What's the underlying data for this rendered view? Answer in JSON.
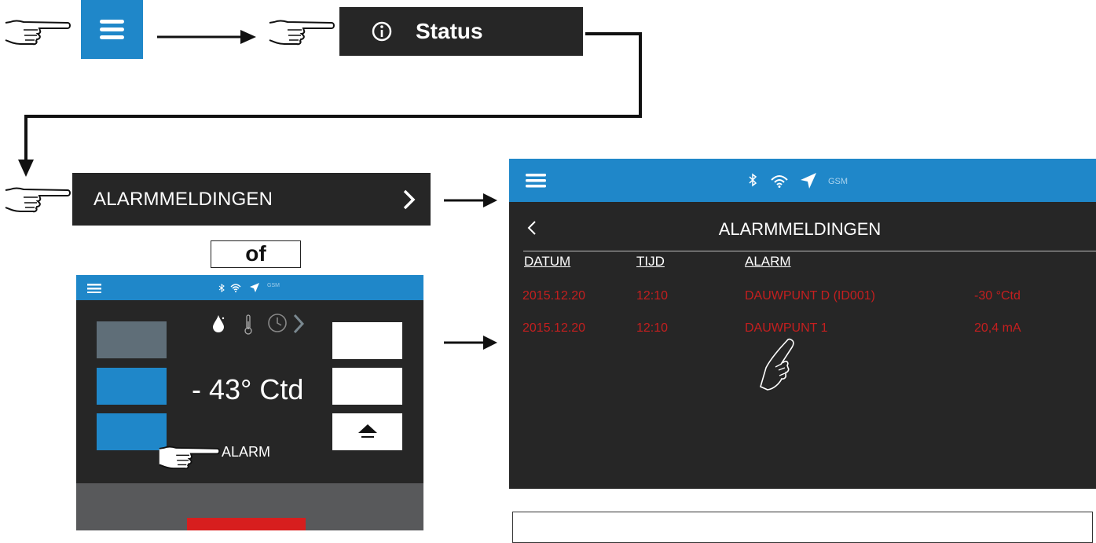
{
  "status_menu": {
    "label": "Status"
  },
  "settings_row": {
    "label": "ALARMMELDINGEN"
  },
  "or_label": "of",
  "small_device": {
    "status_icons": {
      "gsm": "GSM"
    },
    "reading": "- 43° Ctd",
    "alarm_label": "ALARM"
  },
  "alarm_screen": {
    "status_icons": {
      "gsm": "GSM"
    },
    "title": "ALARMMELDINGEN",
    "columns": [
      "DATUM",
      "TIJD",
      "ALARM"
    ],
    "rows": [
      {
        "date": "2015.12.20",
        "time": "12:10",
        "alarm": "DAUWPUNT D (ID001)",
        "value": "-30 °Ctd"
      },
      {
        "date": "2015.12.20",
        "time": "12:10",
        "alarm": "DAUWPUNT 1",
        "value": "20,4 mA"
      }
    ]
  },
  "colors": {
    "accent_blue": "#1f87c9",
    "panel_dark": "#262626",
    "alarm_red": "#c51f1f"
  },
  "icons": [
    "pointing-hand-icon",
    "hamburger-menu-icon",
    "info-icon",
    "chevron-right-icon",
    "bluetooth-icon",
    "wifi-icon",
    "location-arrow-icon",
    "drop-icon",
    "thermometer-icon",
    "clock-icon",
    "upload-icon",
    "back-chevron-icon",
    "touch-hand-icon"
  ]
}
